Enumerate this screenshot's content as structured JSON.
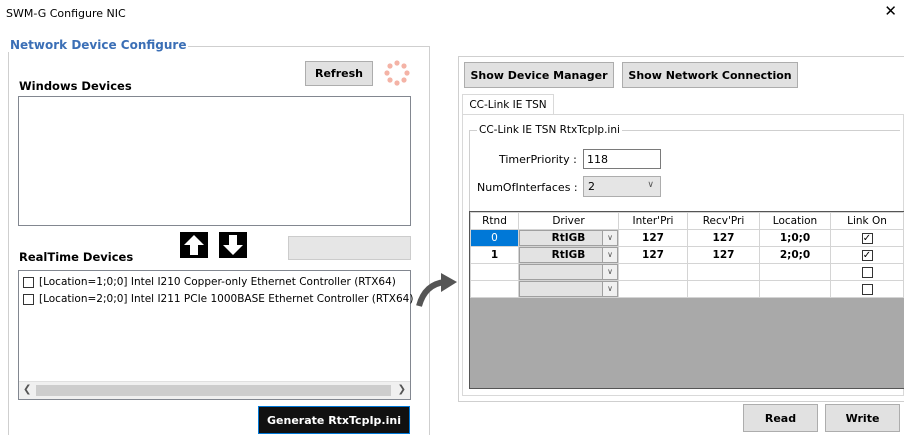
{
  "window": {
    "title": "SWM-G Configure NIC",
    "close": "✕"
  },
  "left": {
    "group_title": "Network Device Configure",
    "windows_devices_label": "Windows Devices",
    "refresh_label": "Refresh",
    "realtime_devices_label": "RealTime Devices",
    "devices": [
      "[Location=1;0;0] Intel I210 Copper-only Ethernet Controller (RTX64)",
      "[Location=2;0;0] Intel I211 PCIe 1000BASE Ethernet Controller (RTX64)"
    ],
    "generate_label": "Generate RtxTcpIp.ini"
  },
  "right": {
    "show_device_manager": "Show Device Manager",
    "show_network_connection": "Show Network Connection",
    "tab_label": "CC-Link IE TSN",
    "ini_group_title": "CC-Link IE TSN RtxTcpIp.ini",
    "timer_priority_label": "TimerPriority :",
    "timer_priority_value": "118",
    "num_interfaces_label": "NumOfInterfaces :",
    "num_interfaces_value": "2",
    "table": {
      "headers": [
        "Rtnd",
        "Driver",
        "Inter'Pri",
        "Recv'Pri",
        "Location",
        "Link On"
      ],
      "rows": [
        {
          "rtnd": "0",
          "driver": "RtIGB",
          "inter": "127",
          "recv": "127",
          "location": "1;0;0",
          "link_on": true
        },
        {
          "rtnd": "1",
          "driver": "RtIGB",
          "inter": "127",
          "recv": "127",
          "location": "2;0;0",
          "link_on": true
        },
        {
          "rtnd": "",
          "driver": "",
          "inter": "",
          "recv": "",
          "location": "",
          "link_on": false
        },
        {
          "rtnd": "",
          "driver": "",
          "inter": "",
          "recv": "",
          "location": "",
          "link_on": false
        }
      ]
    },
    "read_label": "Read",
    "write_label": "Write"
  }
}
